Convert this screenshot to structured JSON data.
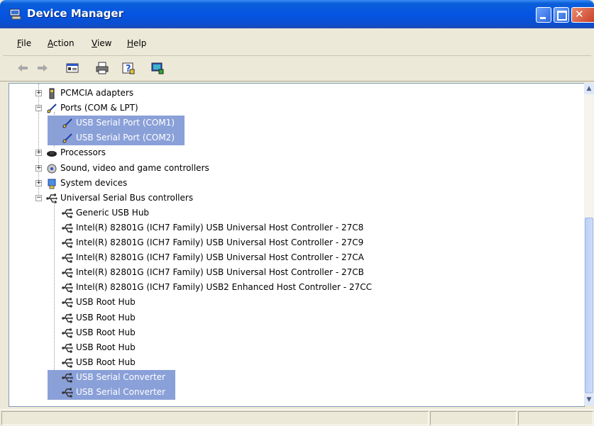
{
  "window": {
    "title": "Device Manager",
    "title_icon": "device-manager-icon"
  },
  "menu": [
    {
      "hotkey": "F",
      "rest": "ile"
    },
    {
      "hotkey": "A",
      "rest": "ction"
    },
    {
      "hotkey": "V",
      "rest": "iew"
    },
    {
      "hotkey": "H",
      "rest": "elp"
    }
  ],
  "toolbar": {
    "icons": [
      "back-arrow-icon",
      "forward-arrow-icon",
      "properties-icon",
      "print-icon",
      "help-icon",
      "monitor-icon"
    ]
  },
  "tree": {
    "rows": [
      {
        "label": "PCMCIA adapters",
        "expander": "+",
        "icon": "pcmcia-icon"
      },
      {
        "label": "Ports (COM & LPT)",
        "expander": "−",
        "icon": "port-icon"
      },
      {
        "label": "USB Serial Port (COM1)",
        "icon": "port-icon",
        "selected": true
      },
      {
        "label": "USB Serial Port (COM2)",
        "icon": "port-icon",
        "selected": true
      },
      {
        "label": "Processors",
        "expander": "+",
        "icon": "processor-icon"
      },
      {
        "label": "Sound, video and game controllers",
        "expander": "+",
        "icon": "sound-icon"
      },
      {
        "label": "System devices",
        "expander": "+",
        "icon": "system-icon"
      },
      {
        "label": "Universal Serial Bus controllers",
        "expander": "−",
        "icon": "usb-icon"
      },
      {
        "label": "Generic USB Hub",
        "icon": "usb-icon"
      },
      {
        "label": "Intel(R) 82801G (ICH7 Family) USB Universal Host Controller - 27C8",
        "icon": "usb-icon"
      },
      {
        "label": "Intel(R) 82801G (ICH7 Family) USB Universal Host Controller - 27C9",
        "icon": "usb-icon"
      },
      {
        "label": "Intel(R) 82801G (ICH7 Family) USB Universal Host Controller - 27CA",
        "icon": "usb-icon"
      },
      {
        "label": "Intel(R) 82801G (ICH7 Family) USB Universal Host Controller - 27CB",
        "icon": "usb-icon"
      },
      {
        "label": "Intel(R) 82801G (ICH7 Family) USB2 Enhanced Host Controller - 27CC",
        "icon": "usb-icon"
      },
      {
        "label": "USB Root Hub",
        "icon": "usb-icon"
      },
      {
        "label": "USB Root Hub",
        "icon": "usb-icon"
      },
      {
        "label": "USB Root Hub",
        "icon": "usb-icon"
      },
      {
        "label": "USB Root Hub",
        "icon": "usb-icon"
      },
      {
        "label": "USB Root Hub",
        "icon": "usb-icon"
      },
      {
        "label": "USB Serial Converter",
        "icon": "usb-icon",
        "selected": true
      },
      {
        "label": "USB Serial Converter",
        "icon": "usb-icon",
        "selected": true
      }
    ]
  },
  "colors": {
    "selection": "#8aa0d8",
    "titlebar": "#0554e3"
  }
}
